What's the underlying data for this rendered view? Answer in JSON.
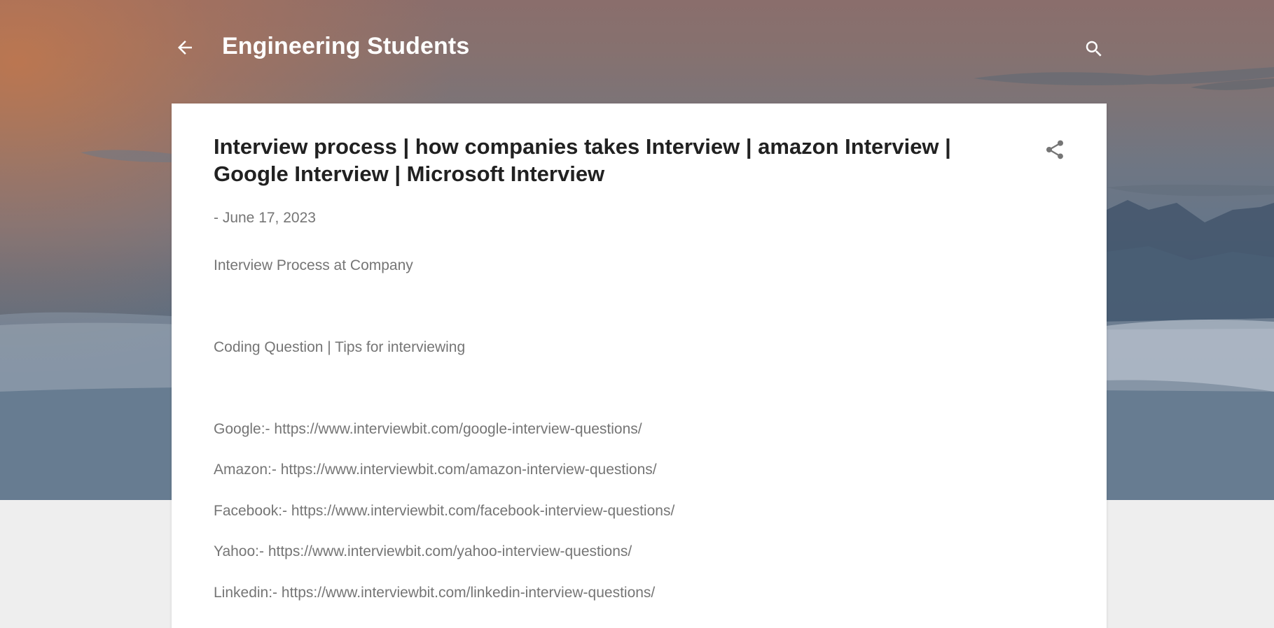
{
  "header": {
    "back_icon": "arrow-left-icon",
    "blog_title": "Engineering Students",
    "search_icon": "search-icon"
  },
  "post": {
    "title": "Interview process | how companies takes Interview | amazon Interview | Google Interview | Microsoft Interview",
    "share_icon": "share-icon",
    "date": "- June 17, 2023",
    "intro": " Interview Process at Company",
    "subheading": "Coding Question | Tips for interviewing",
    "links": [
      {
        "label": "Google:- ",
        "url": "https://www.interviewbit.com/google-interview-questions/"
      },
      {
        "label": "Amazon:- ",
        "url": "https://www.interviewbit.com/amazon-interview-questions/"
      },
      {
        "label": "Facebook:- ",
        "url": "https://www.interviewbit.com/facebook-interview-questions/"
      },
      {
        "label": "Yahoo:- ",
        "url": "https://www.interviewbit.com/yahoo-interview-questions/"
      },
      {
        "label": "Linkedin:- ",
        "url": "https://www.interviewbit.com/linkedin-interview-questions/"
      }
    ]
  },
  "colors": {
    "title_text": "#212121",
    "body_text": "#757575",
    "header_text": "#ffffff",
    "page_background": "#eeeeee"
  }
}
